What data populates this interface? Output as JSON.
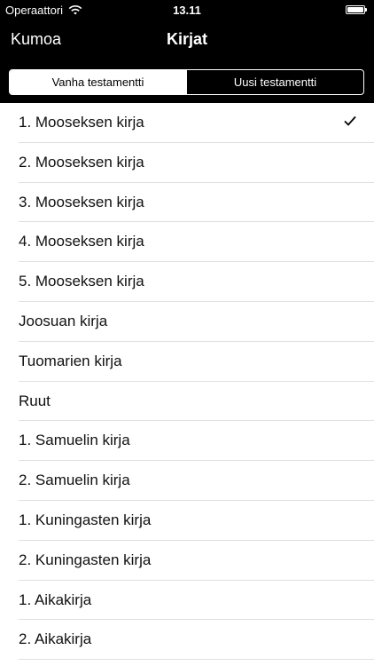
{
  "status_bar": {
    "carrier": "Operaattori",
    "time": "13.11"
  },
  "nav": {
    "back_label": "Kumoa",
    "title": "Kirjat"
  },
  "segments": [
    {
      "label": "Vanha testamentti",
      "selected": true
    },
    {
      "label": "Uusi testamentti",
      "selected": false
    }
  ],
  "books": [
    {
      "label": "1. Mooseksen kirja",
      "checked": true
    },
    {
      "label": "2. Mooseksen kirja",
      "checked": false
    },
    {
      "label": "3. Mooseksen kirja",
      "checked": false
    },
    {
      "label": "4. Mooseksen kirja",
      "checked": false
    },
    {
      "label": "5. Mooseksen kirja",
      "checked": false
    },
    {
      "label": "Joosuan kirja",
      "checked": false
    },
    {
      "label": "Tuomarien kirja",
      "checked": false
    },
    {
      "label": "Ruut",
      "checked": false
    },
    {
      "label": "1. Samuelin kirja",
      "checked": false
    },
    {
      "label": "2. Samuelin kirja",
      "checked": false
    },
    {
      "label": "1. Kuningasten kirja",
      "checked": false
    },
    {
      "label": "2. Kuningasten kirja",
      "checked": false
    },
    {
      "label": "1. Aikakirja",
      "checked": false
    },
    {
      "label": "2. Aikakirja",
      "checked": false
    }
  ],
  "colors": {
    "bar_background": "#000000",
    "bar_text": "#ffffff",
    "list_background": "#ffffff",
    "separator": "#e0e0e0"
  },
  "icons": {
    "wifi": "wifi-icon",
    "battery": "battery-icon",
    "checkmark": "checkmark-icon"
  }
}
